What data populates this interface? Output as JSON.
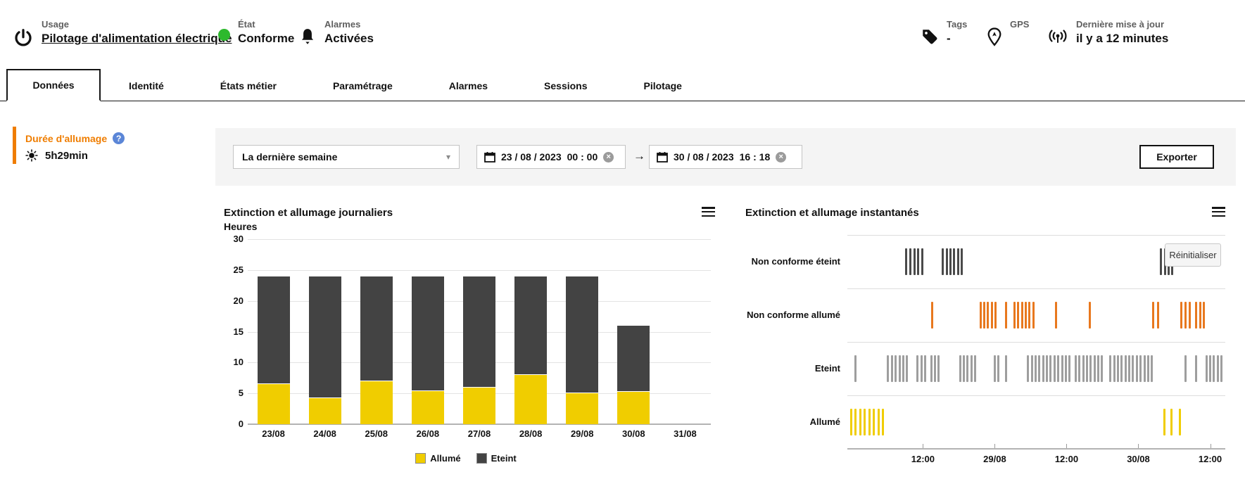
{
  "header": {
    "usage_label": "Usage",
    "usage_value": "Pilotage d'alimentation électrique",
    "etat_label": "État",
    "etat_value": "Conforme",
    "status_color": "#2db92d",
    "alarmes_label": "Alarmes",
    "alarmes_value": "Activées",
    "tags_label": "Tags",
    "tags_value": "-",
    "gps_label": "GPS",
    "maj_label": "Dernière mise à jour",
    "maj_value": "il y a 12 minutes"
  },
  "tabs": [
    {
      "label": "Données",
      "active": true
    },
    {
      "label": "Identité",
      "active": false
    },
    {
      "label": "États métier",
      "active": false
    },
    {
      "label": "Paramétrage",
      "active": false
    },
    {
      "label": "Alarmes",
      "active": false
    },
    {
      "label": "Sessions",
      "active": false
    },
    {
      "label": "Pilotage",
      "active": false
    }
  ],
  "sidebar": {
    "metric_label": "Durée d'allumage",
    "help_glyph": "?",
    "metric_value": "5h29min",
    "accent_color": "#ef7d00"
  },
  "filterbar": {
    "range_value": "La dernière semaine",
    "caret_glyph": "▾",
    "date_from": "23 / 08 / 2023",
    "time_from": "00 : 00",
    "date_to": "30 / 08 / 2023",
    "time_to": "16 : 18",
    "clear_glyph": "×",
    "arrow_glyph": "→",
    "export_label": "Exporter"
  },
  "chart_data": [
    {
      "id": "daily",
      "type": "bar",
      "title": "Extinction et allumage journaliers",
      "ylabel": "Heures",
      "categories": [
        "23/08",
        "24/08",
        "25/08",
        "26/08",
        "27/08",
        "28/08",
        "29/08",
        "30/08",
        "31/08"
      ],
      "series": [
        {
          "name": "Allumé",
          "color": "#f0cd00",
          "values": [
            6.5,
            4.2,
            7,
            5.4,
            5.9,
            8,
            5,
            5.3,
            0
          ]
        },
        {
          "name": "Eteint",
          "color": "#434343",
          "values": [
            17.5,
            19.8,
            17,
            18.6,
            18.1,
            16,
            19,
            10.7,
            0
          ]
        }
      ],
      "ylim": [
        0,
        30
      ],
      "yticks": [
        0,
        5,
        10,
        15,
        20,
        25,
        30
      ],
      "legend_position": "bottom"
    },
    {
      "id": "instant",
      "type": "event-timeline",
      "title": "Extinction et allumage instantanés",
      "reset_button": "Réinitialiser",
      "xticks": [
        "12:00",
        "29/08",
        "12:00",
        "30/08",
        "12:00"
      ],
      "xtick_fracs": [
        0.2,
        0.39,
        0.58,
        0.77,
        0.96
      ],
      "rows": [
        {
          "label": "Non conforme éteint",
          "color": "#4a4a4a",
          "ticks": [
            0.155,
            0.166,
            0.177,
            0.188,
            0.199,
            0.253,
            0.263,
            0.273,
            0.283,
            0.293,
            0.303,
            0.83,
            0.84,
            0.85,
            0.86
          ]
        },
        {
          "label": "Non conforme allumé",
          "color": "#e8781e",
          "ticks": [
            0.225,
            0.352,
            0.362,
            0.372,
            0.382,
            0.392,
            0.42,
            0.442,
            0.452,
            0.462,
            0.472,
            0.482,
            0.492,
            0.553,
            0.642,
            0.81,
            0.822,
            0.884,
            0.895,
            0.906,
            0.922,
            0.933,
            0.944
          ]
        },
        {
          "label": "Eteint",
          "color": "#9e9e9e",
          "ticks": [
            0.022,
            0.108,
            0.118,
            0.128,
            0.138,
            0.148,
            0.158,
            0.186,
            0.196,
            0.206,
            0.222,
            0.232,
            0.242,
            0.298,
            0.308,
            0.318,
            0.328,
            0.338,
            0.39,
            0.4,
            0.42,
            0.478,
            0.488,
            0.498,
            0.508,
            0.518,
            0.528,
            0.538,
            0.548,
            0.558,
            0.568,
            0.578,
            0.588,
            0.604,
            0.614,
            0.624,
            0.634,
            0.644,
            0.654,
            0.664,
            0.674,
            0.696,
            0.706,
            0.716,
            0.726,
            0.736,
            0.746,
            0.756,
            0.766,
            0.776,
            0.786,
            0.796,
            0.806,
            0.894,
            0.922,
            0.95,
            0.96,
            0.97,
            0.98,
            0.99
          ]
        },
        {
          "label": "Allumé",
          "color": "#f0cd00",
          "ticks": [
            0.01,
            0.022,
            0.034,
            0.046,
            0.058,
            0.07,
            0.082,
            0.094,
            0.838,
            0.858,
            0.88
          ]
        }
      ]
    }
  ]
}
